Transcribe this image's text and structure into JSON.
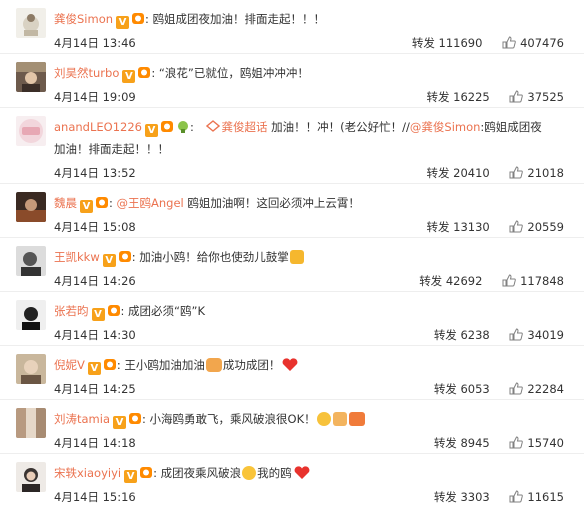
{
  "comments": [
    {
      "user": "龚俊Simon",
      "text": "鸥姐成团夜加油！排面走起！！！",
      "date": "4月14日 13:46",
      "repost_label": "转发",
      "reposts": "111690",
      "likes": "407476"
    },
    {
      "user": "刘昊然turbo",
      "text": "“浪花”已就位，鸥姐冲冲冲！",
      "date": "4月14日 19:09",
      "repost_label": "转发",
      "reposts": "16225",
      "likes": "37525"
    },
    {
      "user": "anandLEO1226",
      "mention_prefix": "龚俊超话",
      "text": "加油！！冲！(老公好忙！//",
      "mention": "@龚俊Simon",
      "text2": ":鸥姐成团夜",
      "line2": "加油！排面走起！！！",
      "date": "4月14日 13:52",
      "repost_label": "转发",
      "reposts": "20410",
      "likes": "21018"
    },
    {
      "user": "魏晨",
      "mention": "@王鸥Angel",
      "text": "鸥姐加油啊！这回必须冲上云霄！",
      "date": "4月14日 15:08",
      "repost_label": "转发",
      "reposts": "13130",
      "likes": "20559"
    },
    {
      "user": "王凯kkw",
      "text": "加油小鸥！给你也使劲儿鼓掌",
      "date": "4月14日 14:26",
      "repost_label": "转发",
      "reposts": "42692",
      "likes": "117848"
    },
    {
      "user": "张若昀",
      "text": "成团必须“鸥”K",
      "date": "4月14日 14:30",
      "repost_label": "转发",
      "reposts": "6238",
      "likes": "34019"
    },
    {
      "user": "倪妮V",
      "text": "王小鸥加油加油",
      "text2": "成功成团！",
      "date": "4月14日 14:25",
      "repost_label": "转发",
      "reposts": "6053",
      "likes": "22284"
    },
    {
      "user": "刘涛tamia",
      "text": "小海鸥勇敢飞，乘风破浪很OK！",
      "date": "4月14日 14:18",
      "repost_label": "转发",
      "reposts": "8945",
      "likes": "15740"
    },
    {
      "user": "宋轶xiaoyiyi",
      "text": "成团夜乘风破浪",
      "text2": "我的鸥",
      "date": "4月14日 15:16",
      "repost_label": "转发",
      "reposts": "3303",
      "likes": "11615"
    }
  ],
  "labels": {
    "colon": ":",
    "badge": "V"
  },
  "colors": {
    "name": "#eb7350",
    "text": "#333333",
    "badge": "#f7a11a"
  }
}
